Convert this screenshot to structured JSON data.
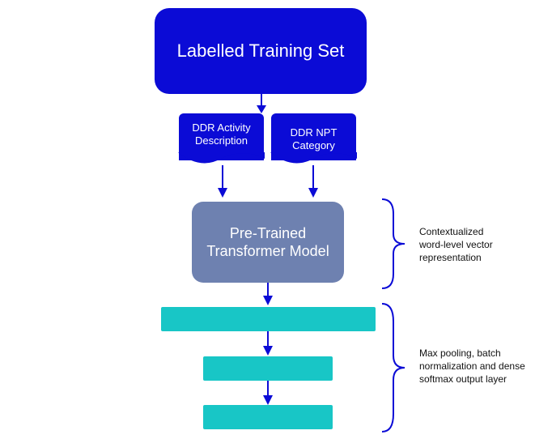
{
  "diagram": {
    "training_set": "Labelled Training Set",
    "doc_left_line1": "DDR Activity",
    "doc_left_line2": "Description",
    "doc_right_line1": "DDR NPT Category",
    "pretrained": "Pre-Trained\nTransformer Model",
    "bar1": "",
    "bar2": "",
    "bar3": "",
    "annot_top": "Contextualized\nword-level vector\nrepresentation",
    "annot_bottom": "Max pooling, batch\nnormalization and dense\nsoftmax output layer"
  }
}
